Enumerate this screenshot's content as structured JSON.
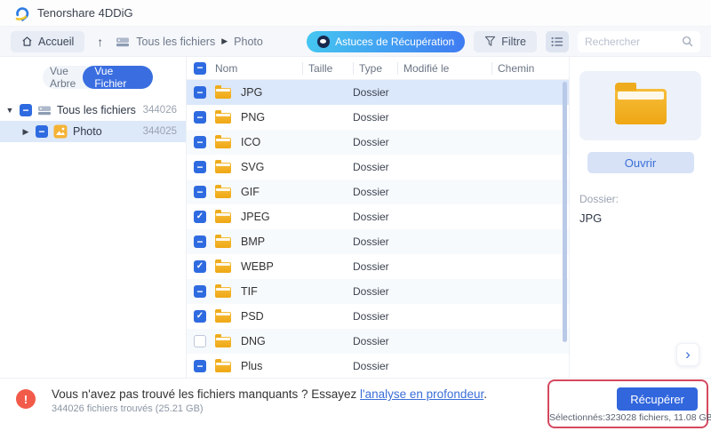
{
  "window": {
    "app_title": "Tenorshare 4DDiG"
  },
  "nav": {
    "home_label": "Accueil",
    "breadcrumb": {
      "root": "Tous les fichiers",
      "current": "Photo"
    },
    "tips_button": "Astuces de Récupération",
    "filter_button": "Filtre",
    "search_placeholder": "Rechercher"
  },
  "sidebar": {
    "view_toggle": {
      "tree_label": "Vue Arbre",
      "file_label": "Vue Fichier",
      "active": "Vue Fichier"
    },
    "tree": [
      {
        "label": "Tous les fichiers",
        "count": "344026",
        "icon": "drive-icon",
        "checkbox": "minus",
        "expanded": true,
        "selected": false
      },
      {
        "label": "Photo",
        "count": "344025",
        "icon": "photo-icon",
        "checkbox": "minus",
        "expanded": false,
        "selected": true
      }
    ]
  },
  "table": {
    "header_checkbox": "minus",
    "columns": [
      "Nom",
      "Taille",
      "Type",
      "Modifié le",
      "Chemin"
    ],
    "rows": [
      {
        "name": "JPG",
        "type": "Dossier",
        "checkbox": "minus",
        "selected": true
      },
      {
        "name": "PNG",
        "type": "Dossier",
        "checkbox": "minus",
        "selected": false
      },
      {
        "name": "ICO",
        "type": "Dossier",
        "checkbox": "minus",
        "selected": false
      },
      {
        "name": "SVG",
        "type": "Dossier",
        "checkbox": "minus",
        "selected": false
      },
      {
        "name": "GIF",
        "type": "Dossier",
        "checkbox": "minus",
        "selected": false
      },
      {
        "name": "JPEG",
        "type": "Dossier",
        "checkbox": "checked",
        "selected": false
      },
      {
        "name": "BMP",
        "type": "Dossier",
        "checkbox": "minus",
        "selected": false
      },
      {
        "name": "WEBP",
        "type": "Dossier",
        "checkbox": "checked",
        "selected": false
      },
      {
        "name": "TIF",
        "type": "Dossier",
        "checkbox": "minus",
        "selected": false
      },
      {
        "name": "PSD",
        "type": "Dossier",
        "checkbox": "checked",
        "selected": false
      },
      {
        "name": "DNG",
        "type": "Dossier",
        "checkbox": "unchecked",
        "selected": false
      },
      {
        "name": "Plus",
        "type": "Dossier",
        "checkbox": "minus",
        "selected": false
      }
    ]
  },
  "preview": {
    "open_button": "Ouvrir",
    "field_label": "Dossier:",
    "field_value": "JPG"
  },
  "footer": {
    "message": "Vous n'avez pas trouvé les fichiers manquants ? Essayez",
    "link_text": "l'analyse en profondeur",
    "suffix": ".",
    "stats": "344026 fichiers trouvés (25.21 GB)",
    "recover_button": "Récupérer",
    "selected_info": "Sélectionnés:323028 fichiers, 11.08 GB"
  },
  "colors": {
    "accent_blue": "#3a6ee0",
    "tips_gradient_start": "#45c6f1",
    "tips_gradient_end": "#3f7bf2",
    "selected_row": "#dbe7fa",
    "folder_yellow": "#f2b01e",
    "warning_red": "#f25b49",
    "annotation_red": "#d5495f",
    "recover_button_blue": "#3166dd"
  },
  "icons": {
    "logo": "swirl",
    "home": "house",
    "up": "↑",
    "drive": "hard-drive",
    "tips": "eye",
    "filter": "funnel",
    "list_view": "list",
    "search": "magnifier",
    "folder": "folder",
    "photo": "picture",
    "warning": "!",
    "chevron_right": "›",
    "breadcrumb_sep": "▸",
    "expander_down": "▾",
    "expander_right": "▸"
  }
}
